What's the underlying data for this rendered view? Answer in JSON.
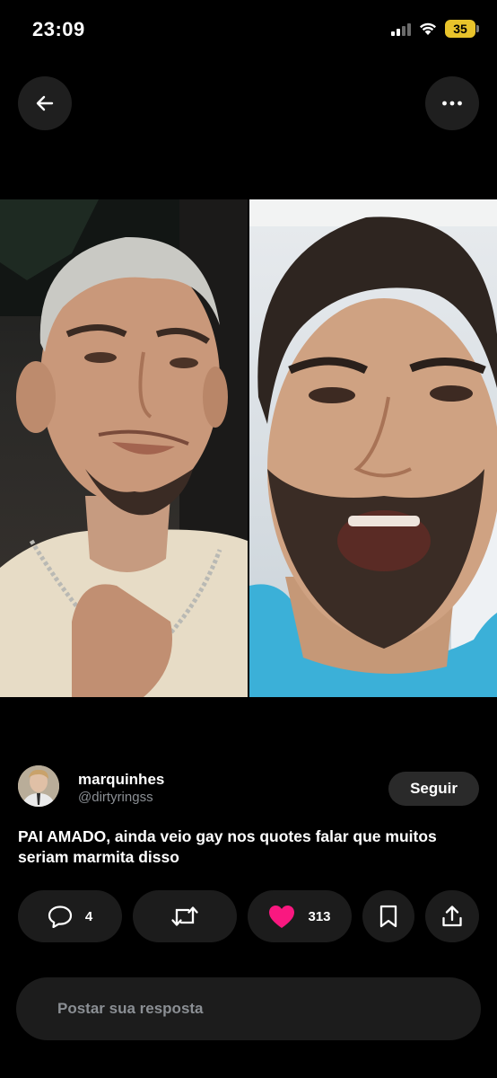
{
  "status_bar": {
    "time": "23:09",
    "battery": "35",
    "icons": [
      "cellular-signal-icon",
      "wifi-icon",
      "battery-icon"
    ]
  },
  "nav": {
    "back_icon": "arrow-left-icon",
    "more_icon": "ellipsis-icon"
  },
  "media": {
    "images": [
      "photo-left",
      "photo-right"
    ]
  },
  "author": {
    "name": "marquinhes",
    "handle": "@dirtyringss",
    "follow_label": "Seguir"
  },
  "tweet": {
    "text": "PAI AMADO, ainda veio gay nos quotes falar que muitos seriam marmita disso"
  },
  "actions": {
    "replies": "4",
    "likes": "313",
    "like_color": "#f91880",
    "icons": [
      "reply-icon",
      "repost-icon",
      "heart-icon",
      "bookmark-icon",
      "share-icon"
    ]
  },
  "reply_composer": {
    "placeholder": "Postar sua resposta"
  },
  "colors": {
    "background": "#000000",
    "pill": "#1c1c1c",
    "muted_text": "#8b8f94",
    "battery": "#e8c32b"
  }
}
